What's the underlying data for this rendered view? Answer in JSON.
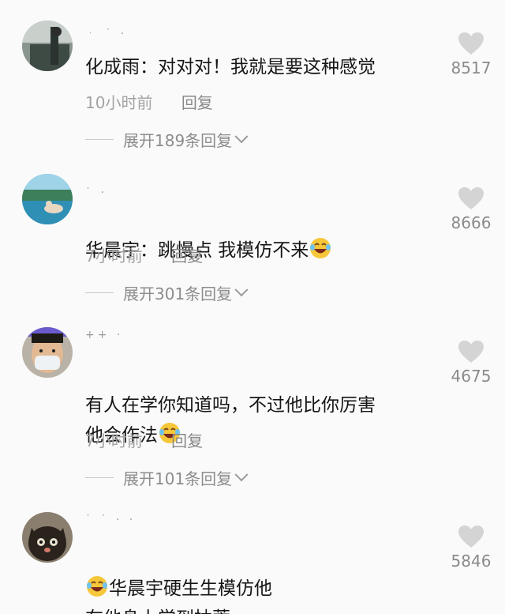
{
  "comments": [
    {
      "text": "化成雨：对对对！我就是要这种感觉",
      "time": "10小时前",
      "reply": "回复",
      "expand": "展开189条回复",
      "likes": "8517",
      "avatar_color": "#4a5a52"
    },
    {
      "text": "华晨宇：跳慢点 我模仿不来",
      "time": "7小时前",
      "reply": "回复",
      "expand": "展开301条回复",
      "likes": "8666",
      "avatar_color": "#3d86a8",
      "emoji": "laughing-crying-icon"
    },
    {
      "text": "有人在学你知道吗，不过他比你厉害\n他会作法",
      "time": "7小时前",
      "reply": "回复",
      "expand": "展开101条回复",
      "likes": "4675",
      "avatar_color": "#caa98a",
      "emoji": "laughing-crying-icon"
    },
    {
      "text": "华晨宇硬生生模仿他\n在他身上学到抽蓄",
      "likes": "5846",
      "avatar_color": "#3a2e25",
      "emoji": "laughing-crying-icon"
    }
  ],
  "colors": {
    "heart": "#d4d4d4",
    "text": "#161616",
    "meta": "#a3a3a3"
  }
}
